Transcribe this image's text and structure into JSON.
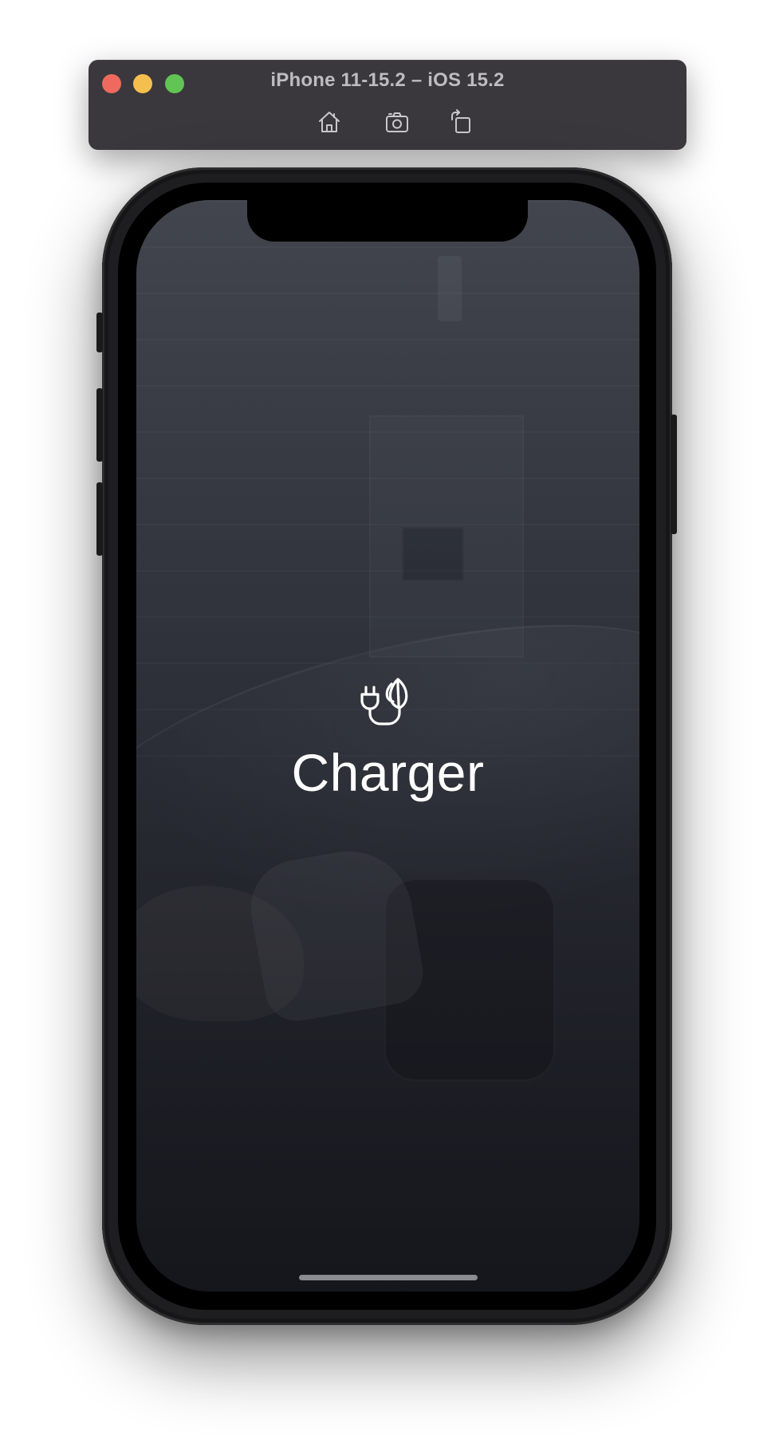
{
  "simulator": {
    "title": "iPhone 11-15.2 – iOS 15.2",
    "controls": [
      {
        "name": "home",
        "icon": "home-icon"
      },
      {
        "name": "screenshot",
        "icon": "camera-icon"
      },
      {
        "name": "rotate",
        "icon": "rotate-icon"
      }
    ],
    "traffic_lights": {
      "close": "#ee6a5f",
      "minimize": "#f5bf4f",
      "zoom": "#61c454"
    }
  },
  "app": {
    "splash": {
      "icon": "plug-leaf-icon",
      "title": "Charger"
    }
  },
  "colors": {
    "toolbar_bg": "#3a383d",
    "title_text": "#bdbcc0",
    "splash_text": "#ffffff",
    "screen_bg_top": "#4b4e57",
    "screen_bg_bottom": "#1a1c22"
  }
}
